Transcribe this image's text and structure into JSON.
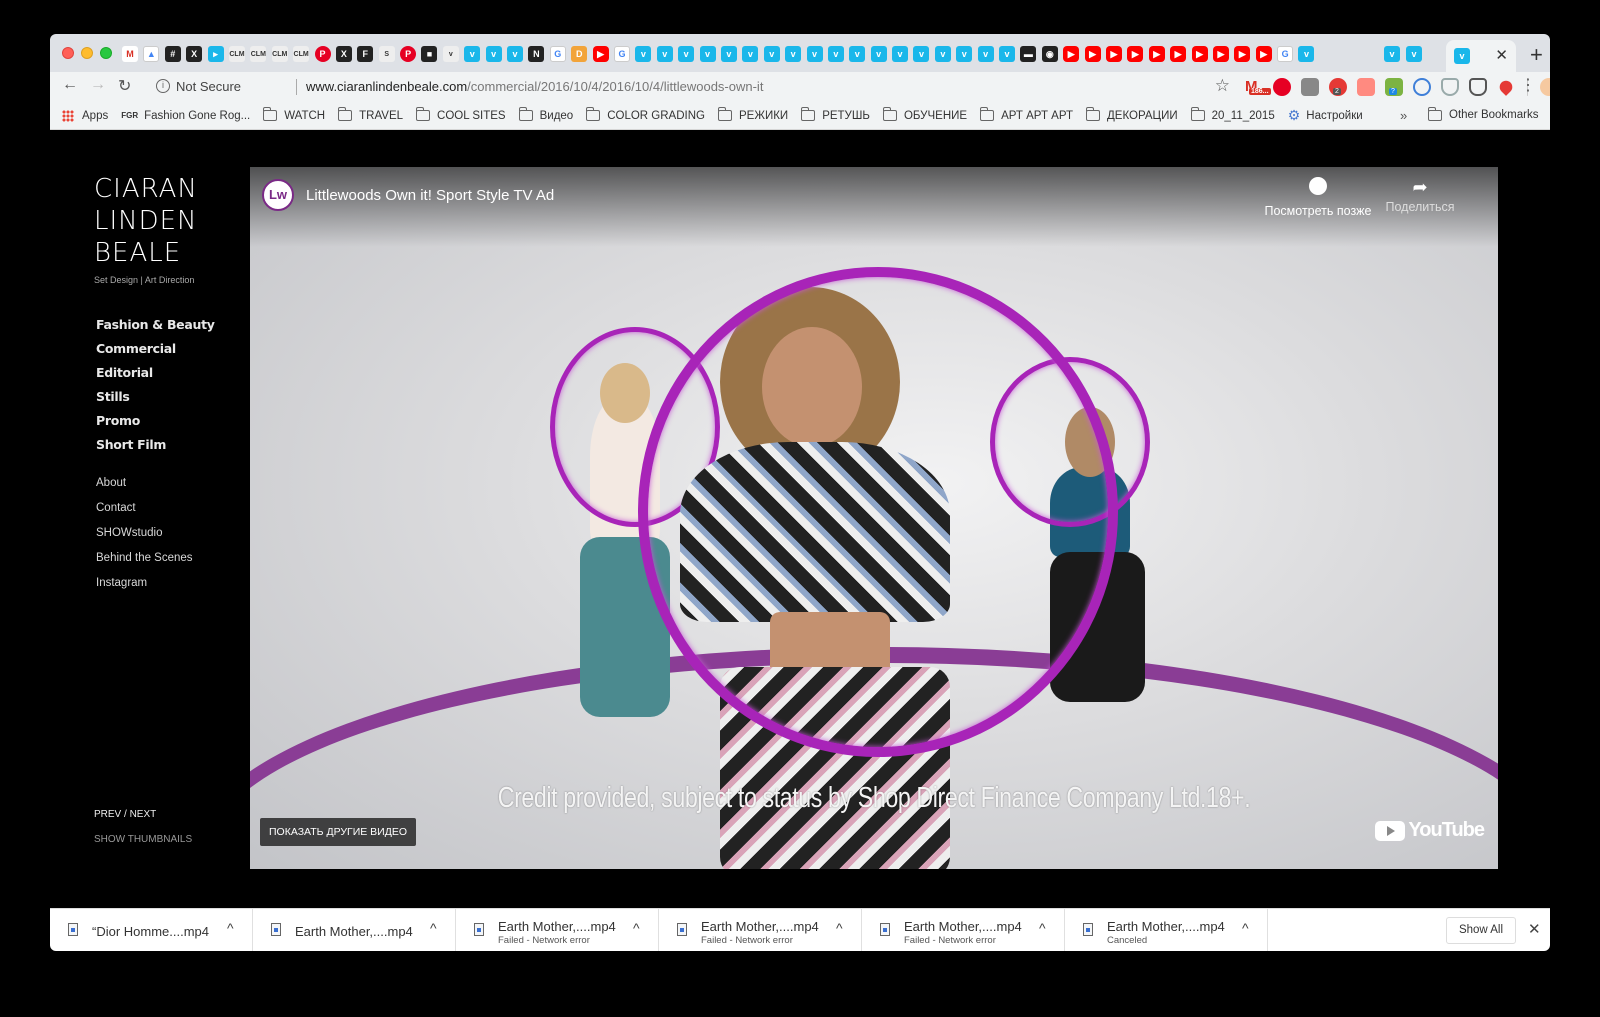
{
  "browser": {
    "address": {
      "security_label": "Not Secure",
      "domain": "www.ciaranlindenbeale.com",
      "path": "/commercial/2016/10/4/2016/10/4/littlewoods-own-it"
    },
    "bookmarks": [
      {
        "label": "Apps",
        "icon": "apps-grid-icon"
      },
      {
        "label": "Fashion Gone Rog...",
        "icon": "fgr-icon"
      },
      {
        "label": "WATCH",
        "icon": "folder-icon"
      },
      {
        "label": "TRAVEL",
        "icon": "folder-icon"
      },
      {
        "label": "COOL SITES",
        "icon": "folder-icon"
      },
      {
        "label": "Видео",
        "icon": "folder-icon"
      },
      {
        "label": "COLOR GRADING",
        "icon": "folder-icon"
      },
      {
        "label": "РЕЖИКИ",
        "icon": "folder-icon"
      },
      {
        "label": "РЕТУШЬ",
        "icon": "folder-icon"
      },
      {
        "label": "ОБУЧЕНИЕ",
        "icon": "folder-icon"
      },
      {
        "label": "АРТ АРТ АРТ",
        "icon": "folder-icon"
      },
      {
        "label": "ДЕКОРАЦИИ",
        "icon": "folder-icon"
      },
      {
        "label": "20_11_2015",
        "icon": "folder-icon"
      },
      {
        "label": "Настройки",
        "icon": "gear-icon"
      }
    ],
    "bookmarks_more": "»",
    "other_bookmarks": "Other Bookmarks",
    "gmail_badge": "186...",
    "ext_badge_1": "2",
    "ext_badge_2": "?",
    "tab_labels": {
      "clm": "CLM"
    }
  },
  "site": {
    "logo_lines": [
      "CIARAN",
      "LINDEN",
      "BEALE"
    ],
    "tagline": "Set Design | Art Direction",
    "nav_primary": [
      "Fashion & Beauty",
      "Commercial",
      "Editorial",
      "Stills",
      "Promo",
      "Short Film"
    ],
    "nav_secondary": [
      "About",
      "Contact",
      "SHOWstudio",
      "Behind the Scenes",
      "Instagram"
    ],
    "prev_next": "PREV / NEXT",
    "show_thumbnails": "SHOW THUMBNAILS"
  },
  "video": {
    "channel_logo": "Lw",
    "title": "Littlewoods Own it! Sport Style TV Ad",
    "watch_later": "Посмотреть позже",
    "share": "Поделиться",
    "caption": "Credit provided, subject to status by Shop Direct Finance Company Ltd.18+.",
    "more_videos": "ПОКАЗАТЬ ДРУГИЕ ВИДЕО",
    "youtube": "YouTube",
    "accent_color": "#a824b8"
  },
  "downloads": {
    "items": [
      {
        "name": "“Dior Homme....mp4",
        "status": ""
      },
      {
        "name": "Earth Mother,....mp4",
        "status": ""
      },
      {
        "name": "Earth Mother,....mp4",
        "status": "Failed - Network error"
      },
      {
        "name": "Earth Mother,....mp4",
        "status": "Failed - Network error"
      },
      {
        "name": "Earth Mother,....mp4",
        "status": "Failed - Network error"
      },
      {
        "name": "Earth Mother,....mp4",
        "status": "Canceled"
      }
    ],
    "show_all": "Show All"
  }
}
